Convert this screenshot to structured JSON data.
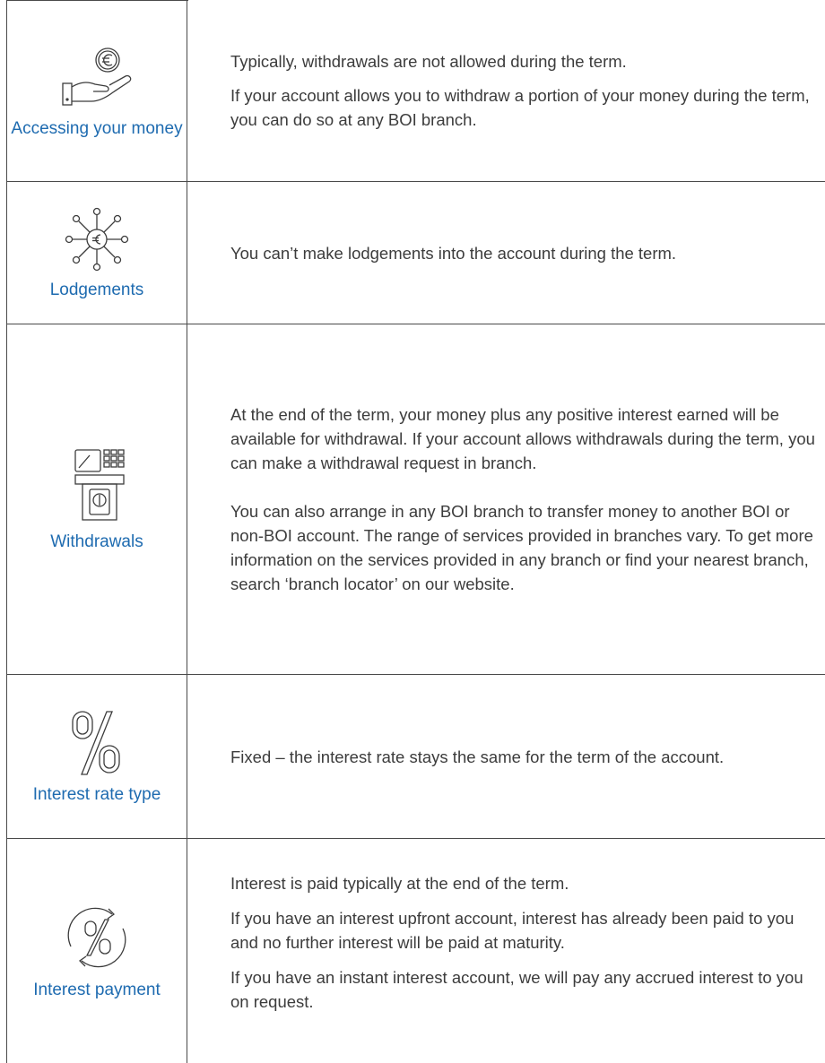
{
  "rows": [
    {
      "icon": "hand-euro-coin-icon",
      "label": "Accessing your money",
      "paragraphs": [
        "Typically, withdrawals are not allowed during the term.",
        "If your account allows you to withdraw a portion of your money during the term, you can do so at any BOI branch."
      ]
    },
    {
      "icon": "euro-network-icon",
      "label": "Lodgements",
      "paragraphs": [
        "You can’t make lodgements into the account during the term."
      ]
    },
    {
      "icon": "atm-card-icon",
      "label": "Withdrawals",
      "paragraphs": [
        "At the end of the term, your money plus any positive interest earned will be available for withdrawal. If your account allows withdrawals during the term, you can make a withdrawal request in branch.",
        "You can also arrange in any BOI branch to transfer money to another BOI or non-BOI account. The range of services provided in branches vary. To get more information on the services provided in any branch or find your nearest branch, search ‘branch locator’ on our website."
      ]
    },
    {
      "icon": "percent-icon",
      "label": "Interest rate type",
      "paragraphs": [
        "Fixed – the interest rate stays the same for the term of the account."
      ]
    },
    {
      "icon": "percent-cycle-icon",
      "label": "Interest payment",
      "paragraphs": [
        "Interest is paid typically at the end of the term.",
        "If you have an interest upfront account, interest has already been paid to you and no further interest will be paid at maturity.",
        "If you have an instant interest account, we will pay any accrued interest to you on request."
      ]
    }
  ],
  "colors": {
    "label": "#1e6bb0",
    "body_text": "#3c3c3c",
    "border": "#4a4a4a"
  }
}
